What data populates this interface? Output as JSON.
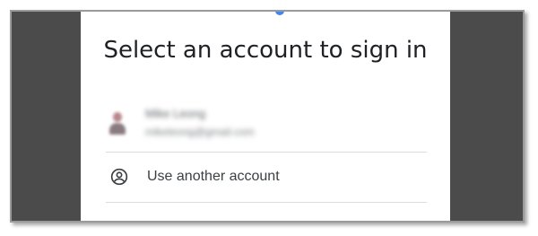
{
  "dialog": {
    "title": "Select an account to sign in",
    "account": {
      "name": "Mike Leong",
      "email": "mikeleong@gmail.com"
    },
    "use_another_label": "Use another account"
  },
  "icons": {
    "use_another": "account-circle-icon",
    "avatar": "profile-photo"
  },
  "colors": {
    "overlay": "#4b4b4b",
    "title_text": "#202124",
    "divider": "#dadce0",
    "accent": "#4285f4"
  }
}
